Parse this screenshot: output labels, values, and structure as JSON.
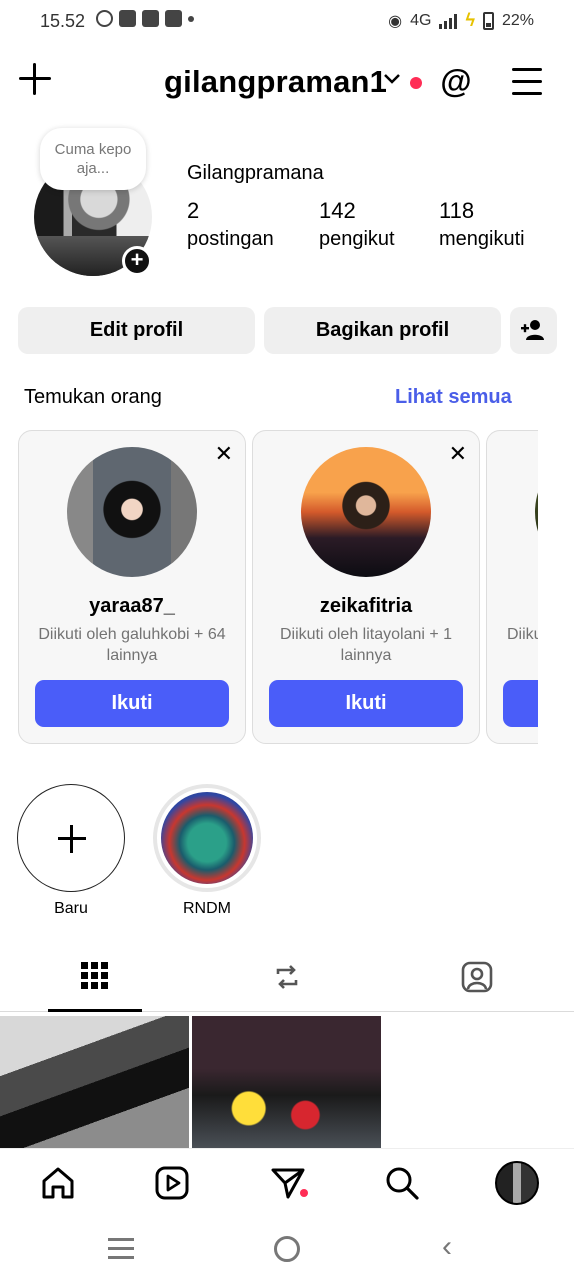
{
  "status_bar": {
    "time": "15.52",
    "network": "4G",
    "battery": "22%"
  },
  "header": {
    "username": "gilangpraman1",
    "icons": [
      "plus-icon",
      "chevron-down-icon",
      "threads-icon",
      "menu-icon"
    ]
  },
  "profile": {
    "note": "Cuma kepo aja...",
    "display_name": "Gilangpramana",
    "stats": [
      {
        "value": "2",
        "label": "postingan"
      },
      {
        "value": "142",
        "label": "pengikut"
      },
      {
        "value": "118",
        "label": "mengikuti"
      }
    ],
    "edit_button": "Edit profil",
    "share_button": "Bagikan profil"
  },
  "discover": {
    "title": "Temukan orang",
    "see_all": "Lihat semua",
    "cards": [
      {
        "username": "yaraa87_",
        "followed_by": "Diikuti oleh galuhkobi + 64 lainnya",
        "follow": "Ikuti"
      },
      {
        "username": "zeikafitria",
        "followed_by": "Diikuti oleh litayolani + 1 lainnya",
        "follow": "Ikuti"
      },
      {
        "username": "",
        "followed_by": "Diiku",
        "follow": ""
      }
    ]
  },
  "highlights": [
    {
      "label": "Baru"
    },
    {
      "label": "RNDM"
    }
  ],
  "tabs": [
    "grid-icon",
    "reels-icon",
    "tagged-icon"
  ],
  "bottom_nav": [
    "home-icon",
    "reels-icon",
    "send-icon",
    "search-icon",
    "profile-avatar"
  ]
}
